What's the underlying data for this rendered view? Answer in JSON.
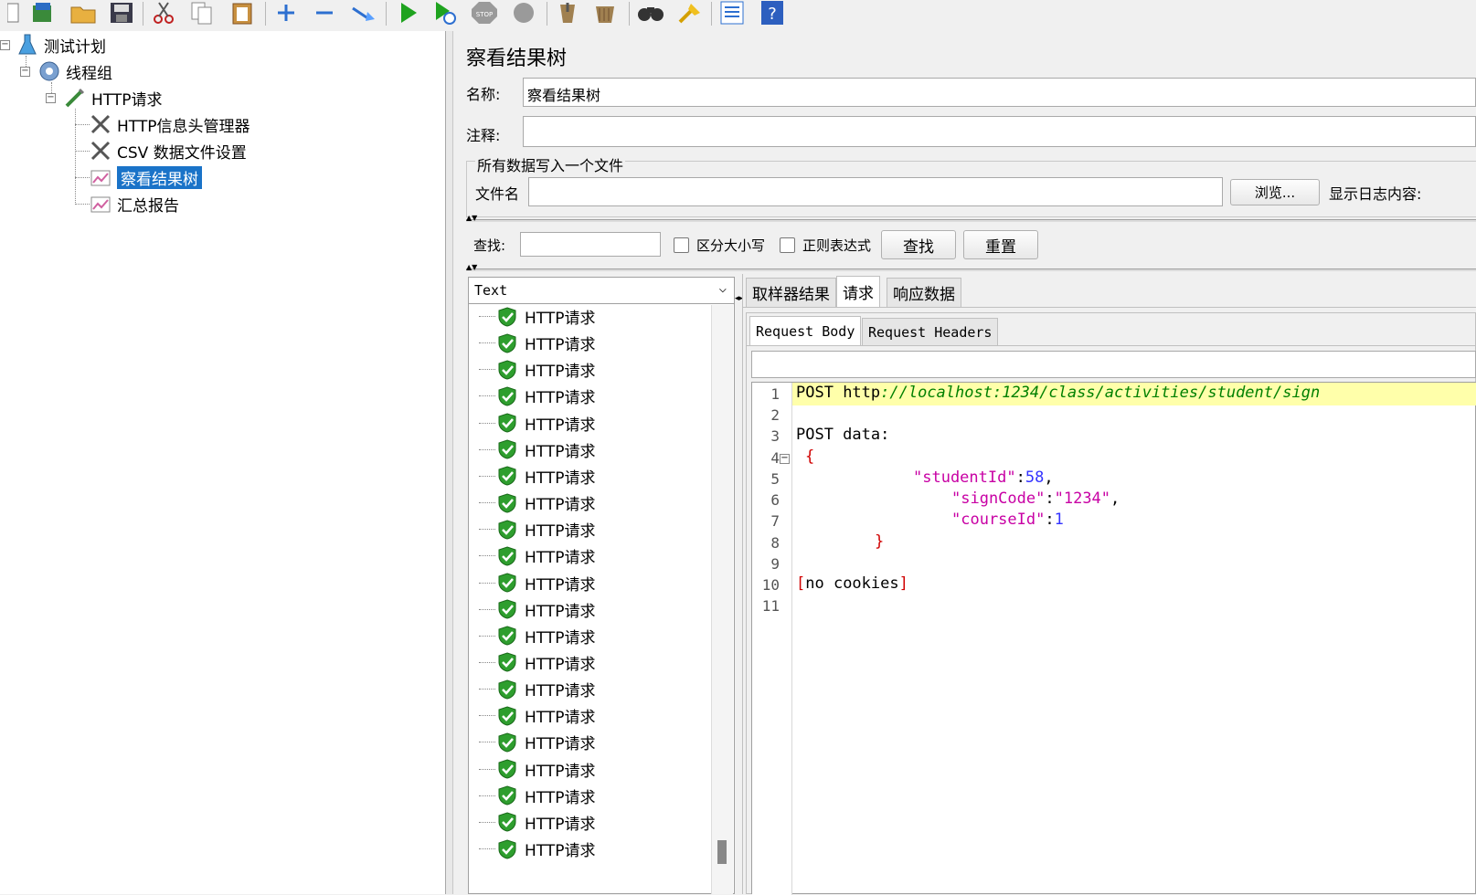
{
  "toolbar": {
    "icons": [
      "new-icon",
      "templates-icon",
      "open-icon",
      "save-icon",
      "cut-icon",
      "copy-icon",
      "paste-icon",
      "expand-icon",
      "collapse-icon",
      "toggle-icon",
      "start-icon",
      "start-no-pause-icon",
      "stop-icon",
      "shutdown-icon",
      "clear-icon",
      "clear-all-icon",
      "search-icon",
      "reset-search-icon",
      "function-helper-icon",
      "help-icon"
    ]
  },
  "tree": {
    "items": [
      {
        "label": "测试计划",
        "icon": "test-plan-icon"
      },
      {
        "label": "线程组",
        "icon": "thread-group-icon"
      },
      {
        "label": "HTTP请求",
        "icon": "http-sampler-icon"
      },
      {
        "label": "HTTP信息头管理器",
        "icon": "config-element-icon"
      },
      {
        "label": "CSV 数据文件设置",
        "icon": "config-element-icon"
      },
      {
        "label": "察看结果树",
        "icon": "listener-icon",
        "selected": true
      },
      {
        "label": "汇总报告",
        "icon": "listener-icon"
      }
    ]
  },
  "panel": {
    "title": "察看结果树",
    "name_label": "名称:",
    "name_value": "察看结果树",
    "comment_label": "注释:",
    "comment_value": "",
    "file_group_label": "所有数据写入一个文件",
    "filename_label": "文件名",
    "filename_value": "",
    "browse_button": "浏览...",
    "log_display_label": "显示日志内容:"
  },
  "search": {
    "label": "查找:",
    "value": "",
    "case_label": "区分大小写",
    "regex_label": "正则表达式",
    "find_button": "查找",
    "reset_button": "重置"
  },
  "results": {
    "renderer": "Text",
    "items": [
      "HTTP请求",
      "HTTP请求",
      "HTTP请求",
      "HTTP请求",
      "HTTP请求",
      "HTTP请求",
      "HTTP请求",
      "HTTP请求",
      "HTTP请求",
      "HTTP请求",
      "HTTP请求",
      "HTTP请求",
      "HTTP请求",
      "HTTP请求",
      "HTTP请求",
      "HTTP请求",
      "HTTP请求",
      "HTTP请求",
      "HTTP请求",
      "HTTP请求",
      "HTTP请求"
    ],
    "status_color": "#2e9e2e"
  },
  "tabs": {
    "items": [
      "取样器结果",
      "请求",
      "响应数据"
    ],
    "active": 1
  },
  "subtabs": {
    "items": [
      "Request Body",
      "Request Headers"
    ],
    "active": 0
  },
  "code": {
    "line_numbers": [
      "1",
      "2",
      "3",
      "4",
      "5",
      "6",
      "7",
      "8",
      "9",
      "10",
      "11"
    ],
    "method": "POST ",
    "scheme": "http",
    "url": "://localhost:1234/class/activities/student/sign",
    "post_data_label": "POST data:",
    "open_brace": "{",
    "key1": "\"studentId\"",
    "val1": "58",
    "key2": "\"signCode\"",
    "val2": "\"1234\"",
    "key3": "\"courseId\"",
    "val3": "1",
    "close_brace": "}",
    "cookies_open": "[",
    "cookies_text": "no cookies",
    "cookies_close": "]"
  },
  "colors": {
    "selection": "#1a73c8",
    "highlight": "#ffffaa",
    "string": "#c800a4",
    "number": "#3333ff",
    "url": "#008000",
    "bracket": "#d00000"
  }
}
